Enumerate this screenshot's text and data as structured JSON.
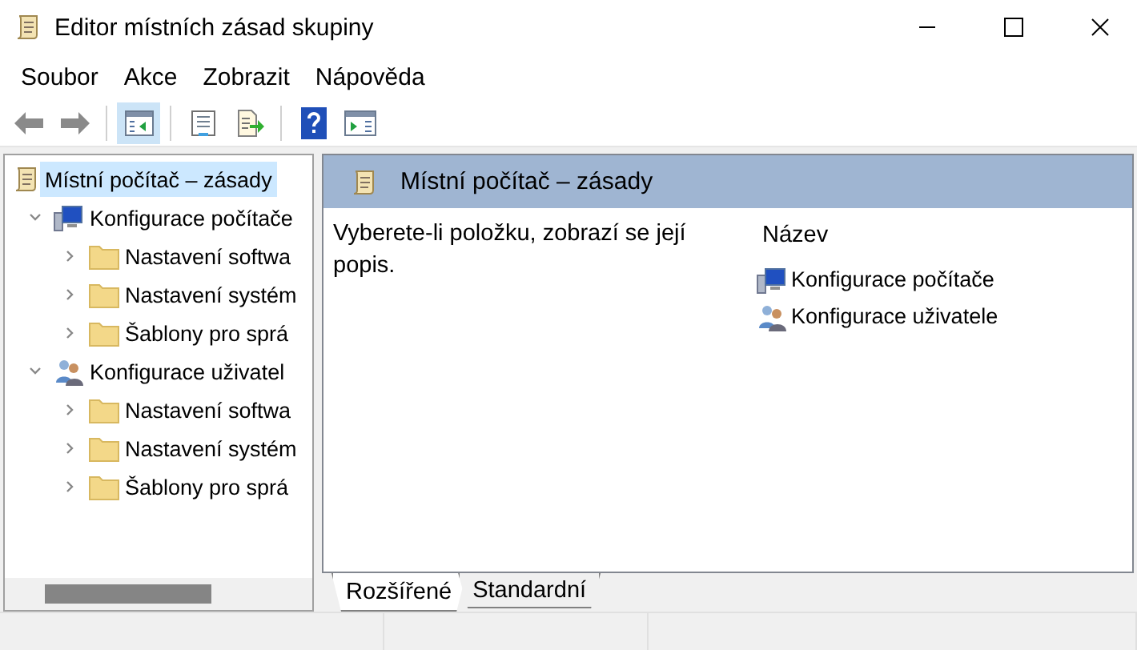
{
  "window": {
    "title": "Editor místních zásad skupiny"
  },
  "menu": [
    "Soubor",
    "Akce",
    "Zobrazit",
    "Nápověda"
  ],
  "toolbar": [
    {
      "kind": "back",
      "pressed": false
    },
    {
      "kind": "forward",
      "pressed": false
    },
    {
      "kind": "tree",
      "pressed": true
    },
    {
      "kind": "properties",
      "pressed": false
    },
    {
      "kind": "export",
      "pressed": false
    },
    {
      "kind": "help",
      "pressed": false
    },
    {
      "kind": "actionpane",
      "pressed": false
    }
  ],
  "tree": [
    {
      "label": "Místní počítač – zásady",
      "kind": "policy",
      "selected": true,
      "children": [
        {
          "label": "Konfigurace počítače",
          "kind": "computer",
          "selected": false,
          "expanded": true,
          "children": [
            {
              "label": "Nastavení softwa",
              "kind": "folder",
              "selected": false,
              "expanded": false
            },
            {
              "label": "Nastavení systém",
              "kind": "folder",
              "selected": false,
              "expanded": false
            },
            {
              "label": "Šablony pro sprá",
              "kind": "folder",
              "selected": false,
              "expanded": false
            }
          ]
        },
        {
          "label": "Konfigurace uživatel",
          "kind": "user",
          "selected": false,
          "expanded": true,
          "children": [
            {
              "label": "Nastavení softwa",
              "kind": "folder",
              "selected": false,
              "expanded": false
            },
            {
              "label": "Nastavení systém",
              "kind": "folder",
              "selected": false,
              "expanded": false
            },
            {
              "label": "Šablony pro sprá",
              "kind": "folder",
              "selected": false,
              "expanded": false
            }
          ]
        }
      ]
    }
  ],
  "details": {
    "header": "Místní počítač – zásady",
    "description": "Vyberete-li položku, zobrazí se její popis.",
    "column": "Název",
    "items": [
      {
        "label": "Konfigurace počítače",
        "kind": "computer"
      },
      {
        "label": "Konfigurace uživatele",
        "kind": "user"
      }
    ]
  },
  "tabs": [
    {
      "label": "Rozšířené",
      "selected": true
    },
    {
      "label": "Standardní",
      "selected": false
    }
  ]
}
